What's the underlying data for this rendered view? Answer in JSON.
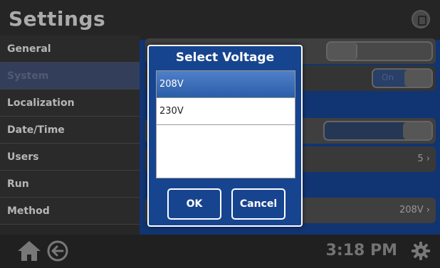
{
  "header": {
    "title": "Settings",
    "power_icon": "power-icon"
  },
  "sidebar": {
    "items": [
      {
        "label": "General",
        "active": false
      },
      {
        "label": "System",
        "active": true
      },
      {
        "label": "Localization",
        "active": false
      },
      {
        "label": "Date/Time",
        "active": false
      },
      {
        "label": "Users",
        "active": false
      },
      {
        "label": "Run",
        "active": false
      },
      {
        "label": "Method",
        "active": false
      }
    ]
  },
  "content": {
    "toggle_on_label": "On",
    "row4_value": "5",
    "row5_value": "208V"
  },
  "modal": {
    "title": "Select Voltage",
    "options": [
      {
        "label": "208V",
        "selected": true
      },
      {
        "label": "230V",
        "selected": false
      }
    ],
    "ok_label": "OK",
    "cancel_label": "Cancel"
  },
  "footer": {
    "time": "3:18 PM",
    "home_icon": "home-icon",
    "back_icon": "back-arrow-icon",
    "settings_icon": "gear-icon"
  },
  "colors": {
    "accent_blue": "#17448e",
    "selection_blue": "#2b5ea9",
    "background_dark": "#2c2c2c"
  }
}
